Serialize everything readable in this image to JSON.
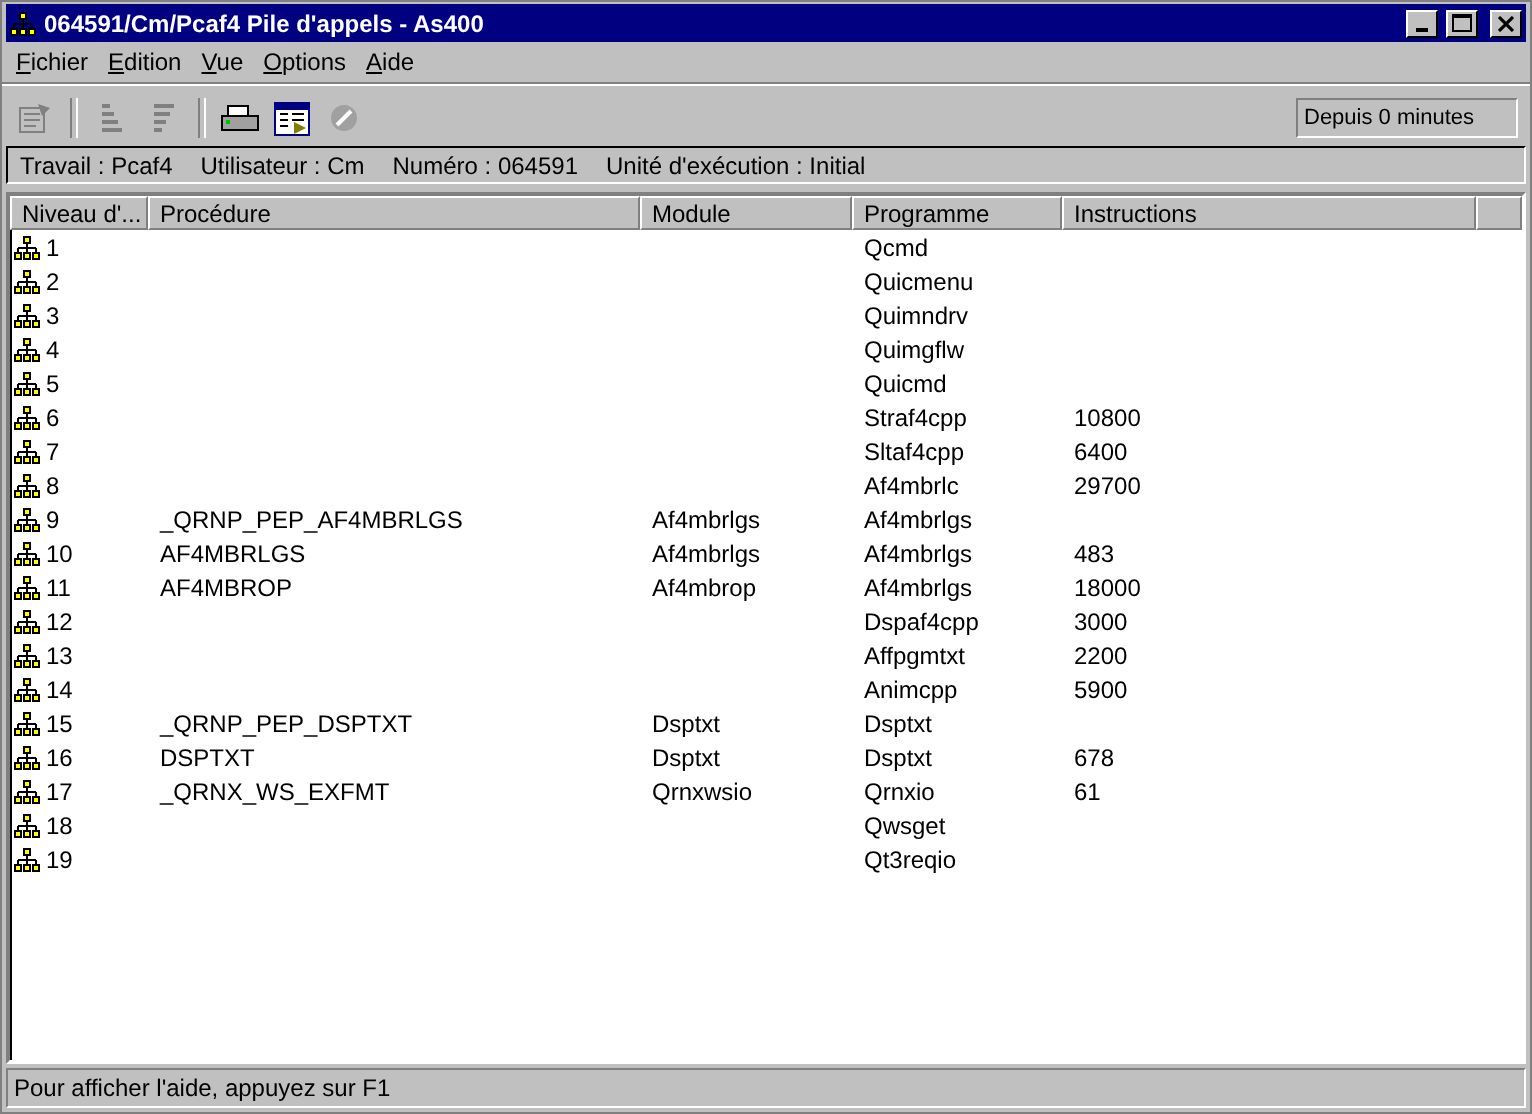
{
  "window": {
    "title": "064591/Cm/Pcaf4 Pile d'appels - As400"
  },
  "menu": [
    "Fichier",
    "Edition",
    "Vue",
    "Options",
    "Aide"
  ],
  "toolbar": {
    "buttons": [
      {
        "kind": "properties",
        "disabled": true
      },
      {
        "kind": "sort-ascending",
        "disabled": true
      },
      {
        "kind": "sort-descending",
        "disabled": true
      },
      {
        "kind": "printer",
        "disabled": false
      },
      {
        "kind": "table-view",
        "disabled": false
      },
      {
        "kind": "stop",
        "disabled": true
      }
    ],
    "elapsed": "Depuis 0 minutes"
  },
  "info_bar": [
    "Travail : Pcaf4",
    "Utilisateur : Cm",
    "Numéro : 064591",
    "Unité d'exécution : Initial"
  ],
  "table": {
    "columns": [
      "Niveau d'...",
      "Procédure",
      "Module",
      "Programme",
      "Instructions"
    ],
    "rows": [
      [
        "1",
        "",
        "",
        "Qcmd",
        ""
      ],
      [
        "2",
        "",
        "",
        "Quicmenu",
        ""
      ],
      [
        "3",
        "",
        "",
        "Quimndrv",
        ""
      ],
      [
        "4",
        "",
        "",
        "Quimgflw",
        ""
      ],
      [
        "5",
        "",
        "",
        "Quicmd",
        ""
      ],
      [
        "6",
        "",
        "",
        "Straf4cpp",
        "10800"
      ],
      [
        "7",
        "",
        "",
        "Sltaf4cpp",
        "6400"
      ],
      [
        "8",
        "",
        "",
        "Af4mbrlc",
        "29700"
      ],
      [
        "9",
        "_QRNP_PEP_AF4MBRLGS",
        "Af4mbrlgs",
        "Af4mbrlgs",
        ""
      ],
      [
        "10",
        "AF4MBRLGS",
        "Af4mbrlgs",
        "Af4mbrlgs",
        "483"
      ],
      [
        "11",
        "AF4MBROP",
        "Af4mbrop",
        "Af4mbrlgs",
        "18000"
      ],
      [
        "12",
        "",
        "",
        "Dspaf4cpp",
        "3000"
      ],
      [
        "13",
        "",
        "",
        "Affpgmtxt",
        "2200"
      ],
      [
        "14",
        "",
        "",
        "Animcpp",
        "5900"
      ],
      [
        "15",
        "_QRNP_PEP_DSPTXT",
        "Dsptxt",
        "Dsptxt",
        ""
      ],
      [
        "16",
        "DSPTXT",
        "Dsptxt",
        "Dsptxt",
        "678"
      ],
      [
        "17",
        "_QRNX_WS_EXFMT",
        "Qrnxwsio",
        "Qrnxio",
        "61"
      ],
      [
        "18",
        "",
        "",
        "Qwsget",
        ""
      ],
      [
        "19",
        "",
        "",
        "Qt3reqio",
        ""
      ]
    ]
  },
  "status_bar": "Pour afficher l'aide, appuyez sur F1"
}
